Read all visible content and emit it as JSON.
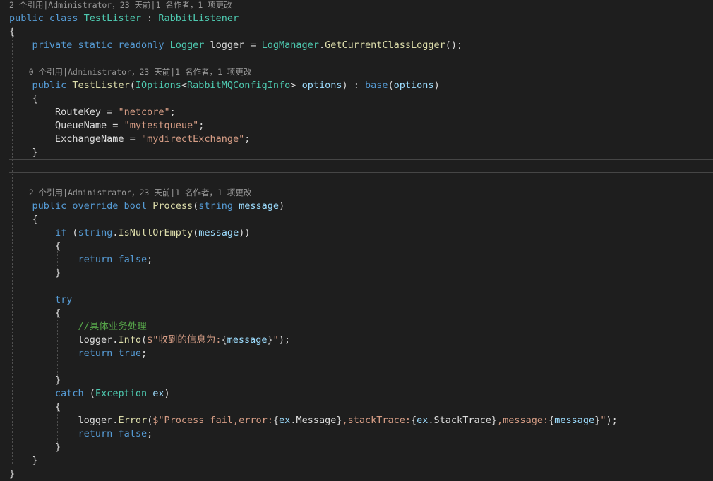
{
  "editor": {
    "lines": [
      {
        "kind": "meta",
        "segments": [
          {
            "c": "meta",
            "t": "2 个引用|Administrator，23 天前|1 名作者，1 项更改"
          }
        ]
      },
      {
        "segments": [
          {
            "c": "kw",
            "t": "public class "
          },
          {
            "c": "ty",
            "t": "TestLister"
          },
          {
            "c": "pl",
            "t": " : "
          },
          {
            "c": "ty",
            "t": "RabbitListener"
          }
        ]
      },
      {
        "segments": [
          {
            "c": "pl",
            "t": "{"
          }
        ]
      },
      {
        "segments": [
          {
            "c": "pl",
            "t": "    "
          },
          {
            "c": "kw",
            "t": "private static readonly "
          },
          {
            "c": "ty",
            "t": "Logger"
          },
          {
            "c": "pl",
            "t": " logger = "
          },
          {
            "c": "ty",
            "t": "LogManager"
          },
          {
            "c": "pl",
            "t": "."
          },
          {
            "c": "fn",
            "t": "GetCurrentClassLogger"
          },
          {
            "c": "pl",
            "t": "();"
          }
        ]
      },
      {
        "segments": []
      },
      {
        "kind": "meta",
        "segments": [
          {
            "c": "meta",
            "t": "    0 个引用|Administrator，23 天前|1 名作者，1 项更改"
          }
        ]
      },
      {
        "segments": [
          {
            "c": "pl",
            "t": "    "
          },
          {
            "c": "kw",
            "t": "public "
          },
          {
            "c": "fn",
            "t": "TestLister"
          },
          {
            "c": "pl",
            "t": "("
          },
          {
            "c": "ty",
            "t": "IOptions"
          },
          {
            "c": "pl",
            "t": "<"
          },
          {
            "c": "ty",
            "t": "RabbitMQConfigInfo"
          },
          {
            "c": "pl",
            "t": "> "
          },
          {
            "c": "id",
            "t": "options"
          },
          {
            "c": "pl",
            "t": ") : "
          },
          {
            "c": "kw",
            "t": "base"
          },
          {
            "c": "pl",
            "t": "("
          },
          {
            "c": "id",
            "t": "options"
          },
          {
            "c": "pl",
            "t": ")"
          }
        ]
      },
      {
        "segments": [
          {
            "c": "pl",
            "t": "    {"
          }
        ]
      },
      {
        "segments": [
          {
            "c": "pl",
            "t": "        RouteKey = "
          },
          {
            "c": "str",
            "t": "\"netcore\""
          },
          {
            "c": "pl",
            "t": ";"
          }
        ]
      },
      {
        "segments": [
          {
            "c": "pl",
            "t": "        QueueName = "
          },
          {
            "c": "str",
            "t": "\"mytestqueue\""
          },
          {
            "c": "pl",
            "t": ";"
          }
        ]
      },
      {
        "segments": [
          {
            "c": "pl",
            "t": "        ExchangeName = "
          },
          {
            "c": "str",
            "t": "\"mydirectExchange\""
          },
          {
            "c": "pl",
            "t": ";"
          }
        ]
      },
      {
        "segments": [
          {
            "c": "pl",
            "t": "    }"
          }
        ]
      },
      {
        "kind": "current",
        "segments": []
      },
      {
        "segments": []
      },
      {
        "kind": "meta",
        "segments": [
          {
            "c": "meta",
            "t": "    2 个引用|Administrator，23 天前|1 名作者，1 项更改"
          }
        ]
      },
      {
        "segments": [
          {
            "c": "pl",
            "t": "    "
          },
          {
            "c": "kw",
            "t": "public override bool "
          },
          {
            "c": "fn",
            "t": "Process"
          },
          {
            "c": "pl",
            "t": "("
          },
          {
            "c": "kw",
            "t": "string "
          },
          {
            "c": "id",
            "t": "message"
          },
          {
            "c": "pl",
            "t": ")"
          }
        ]
      },
      {
        "segments": [
          {
            "c": "pl",
            "t": "    {"
          }
        ]
      },
      {
        "segments": [
          {
            "c": "pl",
            "t": "        "
          },
          {
            "c": "kw",
            "t": "if"
          },
          {
            "c": "pl",
            "t": " ("
          },
          {
            "c": "kw",
            "t": "string"
          },
          {
            "c": "pl",
            "t": "."
          },
          {
            "c": "fn",
            "t": "IsNullOrEmpty"
          },
          {
            "c": "pl",
            "t": "("
          },
          {
            "c": "id",
            "t": "message"
          },
          {
            "c": "pl",
            "t": "))"
          }
        ]
      },
      {
        "segments": [
          {
            "c": "pl",
            "t": "        {"
          }
        ]
      },
      {
        "segments": [
          {
            "c": "pl",
            "t": "            "
          },
          {
            "c": "kw",
            "t": "return false"
          },
          {
            "c": "pl",
            "t": ";"
          }
        ]
      },
      {
        "segments": [
          {
            "c": "pl",
            "t": "        }"
          }
        ]
      },
      {
        "segments": []
      },
      {
        "segments": [
          {
            "c": "pl",
            "t": "        "
          },
          {
            "c": "kw",
            "t": "try"
          }
        ]
      },
      {
        "segments": [
          {
            "c": "pl",
            "t": "        {"
          }
        ]
      },
      {
        "segments": [
          {
            "c": "pl",
            "t": "            "
          },
          {
            "c": "cm",
            "t": "//具体业务处理"
          }
        ]
      },
      {
        "segments": [
          {
            "c": "pl",
            "t": "            logger."
          },
          {
            "c": "fn",
            "t": "Info"
          },
          {
            "c": "pl",
            "t": "("
          },
          {
            "c": "str",
            "t": "$\"收到的信息为:"
          },
          {
            "c": "pl",
            "t": "{"
          },
          {
            "c": "id",
            "t": "message"
          },
          {
            "c": "pl",
            "t": "}"
          },
          {
            "c": "str",
            "t": "\""
          },
          {
            "c": "pl",
            "t": ");"
          }
        ]
      },
      {
        "segments": [
          {
            "c": "pl",
            "t": "            "
          },
          {
            "c": "kw",
            "t": "return true"
          },
          {
            "c": "pl",
            "t": ";"
          }
        ]
      },
      {
        "segments": []
      },
      {
        "segments": [
          {
            "c": "pl",
            "t": "        }"
          }
        ]
      },
      {
        "segments": [
          {
            "c": "pl",
            "t": "        "
          },
          {
            "c": "kw",
            "t": "catch"
          },
          {
            "c": "pl",
            "t": " ("
          },
          {
            "c": "ty",
            "t": "Exception"
          },
          {
            "c": "pl",
            "t": " "
          },
          {
            "c": "id",
            "t": "ex"
          },
          {
            "c": "pl",
            "t": ")"
          }
        ]
      },
      {
        "segments": [
          {
            "c": "pl",
            "t": "        {"
          }
        ]
      },
      {
        "segments": [
          {
            "c": "pl",
            "t": "            logger."
          },
          {
            "c": "fn",
            "t": "Error"
          },
          {
            "c": "pl",
            "t": "("
          },
          {
            "c": "str",
            "t": "$\"Process fail,error:"
          },
          {
            "c": "pl",
            "t": "{"
          },
          {
            "c": "id",
            "t": "ex"
          },
          {
            "c": "pl",
            "t": ".Message}"
          },
          {
            "c": "str",
            "t": ",stackTrace:"
          },
          {
            "c": "pl",
            "t": "{"
          },
          {
            "c": "id",
            "t": "ex"
          },
          {
            "c": "pl",
            "t": ".StackTrace}"
          },
          {
            "c": "str",
            "t": ",message:"
          },
          {
            "c": "pl",
            "t": "{"
          },
          {
            "c": "id",
            "t": "message"
          },
          {
            "c": "pl",
            "t": "}"
          },
          {
            "c": "str",
            "t": "\""
          },
          {
            "c": "pl",
            "t": ");"
          }
        ]
      },
      {
        "segments": [
          {
            "c": "pl",
            "t": "            "
          },
          {
            "c": "kw",
            "t": "return false"
          },
          {
            "c": "pl",
            "t": ";"
          }
        ]
      },
      {
        "segments": [
          {
            "c": "pl",
            "t": "        }"
          }
        ]
      },
      {
        "segments": [
          {
            "c": "pl",
            "t": "    }"
          }
        ]
      },
      {
        "segments": [
          {
            "c": "pl",
            "t": "}"
          }
        ]
      }
    ]
  },
  "colors": {
    "background": "#1e1e1e",
    "keyword": "#569cd6",
    "type": "#4ec9b0",
    "method": "#dcdcaa",
    "string": "#d69d85",
    "comment": "#57a64a",
    "identifier": "#9cdcfe",
    "plain": "#dcdcdc",
    "codelens": "#999999"
  }
}
